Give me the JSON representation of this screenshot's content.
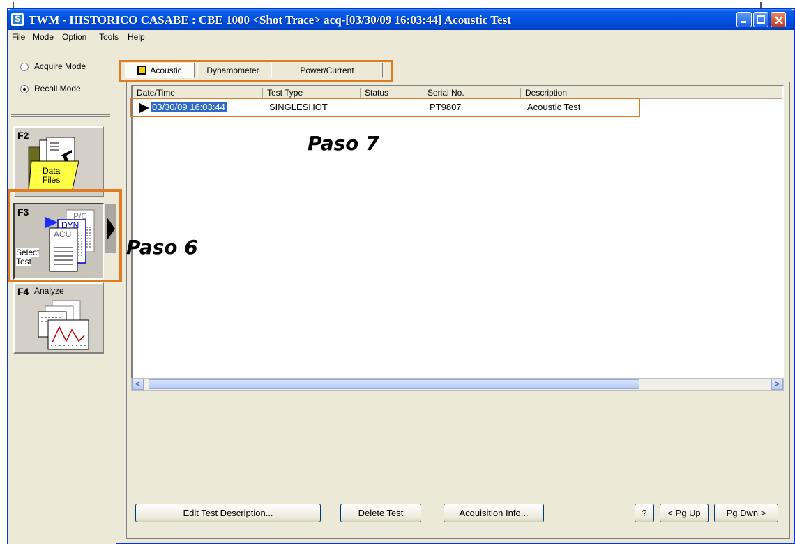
{
  "window": {
    "title": "TWM  - HISTORICO CASABE : CBE 1000  <Shot Trace> acq-[03/30/09 16:03:44] Acoustic Test",
    "icon_letter": "S"
  },
  "menu": [
    "File",
    "Mode",
    "Option",
    "Tools",
    "Help"
  ],
  "sidebar": {
    "modes": [
      {
        "label": "Acquire Mode",
        "selected": false
      },
      {
        "label": "Recall Mode",
        "selected": true
      }
    ],
    "fkeys": [
      {
        "key": "F2",
        "label_line1": "Data",
        "label_line2": "Files",
        "icon": "data-files-icon"
      },
      {
        "key": "F3",
        "label_line1": "Select",
        "label_line2": "Test",
        "icon": "select-test-icon",
        "doc_labels": [
          "P/C",
          "DYN",
          "ACU"
        ]
      },
      {
        "key": "F4",
        "label_line1": "Analyze",
        "icon": "analyze-icon"
      }
    ]
  },
  "tabs": [
    {
      "label": "Acoustic",
      "active": true
    },
    {
      "label": "Dynamometer",
      "active": false
    },
    {
      "label": "Power/Current",
      "active": false
    }
  ],
  "table": {
    "columns": [
      "Date/Time",
      "Test Type",
      "Status",
      "Serial No.",
      "Description"
    ],
    "rows": [
      {
        "date_time": "03/30/09 16:03:44",
        "test_type": "SINGLESHOT",
        "status": "",
        "serial_no": "PT9807",
        "description": "Acoustic Test"
      }
    ]
  },
  "buttons": {
    "edit_test_description": "Edit Test Description...",
    "delete_test": "Delete Test",
    "acquisition_info": "Acquisition Info...",
    "help": "?",
    "pg_up": "< Pg Up",
    "pg_dwn": "Pg Dwn >"
  },
  "annotations": {
    "paso6": "Paso 6",
    "paso7": "Paso 7"
  },
  "colors": {
    "highlight": "#e07c20",
    "title_bar": "#0050e0",
    "selection": "#316ac5"
  }
}
